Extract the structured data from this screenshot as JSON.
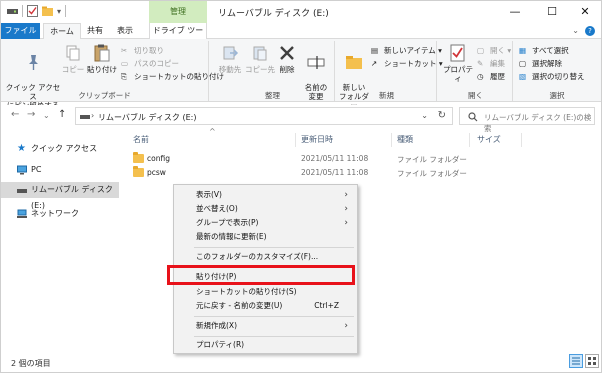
{
  "window": {
    "title": "リムーバブル ディスク (E:)",
    "manage_tab": "管理",
    "minimize": "—",
    "maximize": "☐",
    "close": "✕"
  },
  "tabs": {
    "file": "ファイル",
    "home": "ホーム",
    "share": "共有",
    "view": "表示",
    "drive_tools": "ドライブ ツール",
    "help": "?"
  },
  "ribbon": {
    "clipboard": {
      "label": "クリップボード",
      "pin": "クイック アクセス\nにピン留めする",
      "copy": "コピー",
      "paste": "貼り付け",
      "cut": "切り取り",
      "copy_path": "パスのコピー",
      "paste_shortcut": "ショートカットの貼り付け"
    },
    "organize": {
      "label": "整理",
      "move_to": "移動先",
      "copy_to": "コピー先",
      "delete": "削除",
      "rename": "名前の\n変更"
    },
    "new": {
      "label": "新規",
      "new_folder": "新しい\nフォルダー",
      "new_item": "新しいアイテム ▾",
      "shortcut": "ショートカット ▾"
    },
    "open": {
      "label": "開く",
      "properties": "プロパティ",
      "open": "開く ▾",
      "edit": "編集",
      "history": "履歴"
    },
    "select": {
      "label": "選択",
      "select_all": "すべて選択",
      "select_none": "選択解除",
      "invert": "選択の切り替え"
    }
  },
  "address": {
    "back": "←",
    "forward": "→",
    "dropdown": "⌄",
    "up": "↑",
    "path": "リムーバブル ディスク (E:)",
    "search_placeholder": "リムーバブル ディスク (E:)の検索"
  },
  "navpane": {
    "items": [
      {
        "label": "クイック アクセス"
      },
      {
        "label": "PC"
      },
      {
        "label": "リムーバブル ディスク (E:)"
      },
      {
        "label": "ネットワーク"
      }
    ]
  },
  "filelist": {
    "columns": [
      "名前",
      "更新日時",
      "種類",
      "サイズ"
    ],
    "rows": [
      {
        "name": "config",
        "date": "2021/05/11 11:08",
        "type": "ファイル フォルダー",
        "size": ""
      },
      {
        "name": "pcsw",
        "date": "2021/05/11 11:08",
        "type": "ファイル フォルダー",
        "size": ""
      }
    ]
  },
  "context_menu": {
    "items": [
      {
        "label": "表示(V)",
        "submenu": "›"
      },
      {
        "label": "並べ替え(O)",
        "submenu": "›"
      },
      {
        "label": "グループで表示(P)",
        "submenu": "›"
      },
      {
        "label": "最新の情報に更新(E)"
      },
      {
        "label": "このフォルダーのカスタマイズ(F)..."
      },
      {
        "label": "貼り付け(P)"
      },
      {
        "label": "ショートカットの貼り付け(S)"
      },
      {
        "label": "元に戻す - 名前の変更(U)",
        "shortcut": "Ctrl+Z"
      },
      {
        "label": "新規作成(X)",
        "submenu": "›"
      },
      {
        "label": "プロパティ(R)"
      }
    ]
  },
  "status": {
    "count": "2 個の項目"
  },
  "colors": {
    "file_tab": "#1979ca",
    "manage_tab": "#d2ecbf",
    "highlight_box": "#e8121a",
    "folder": "#f4c04e"
  }
}
